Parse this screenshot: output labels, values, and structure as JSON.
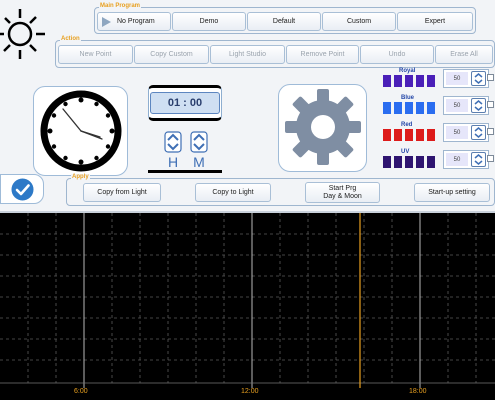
{
  "main_program": {
    "title": "Main Program",
    "buttons": [
      "No Program",
      "Demo",
      "Default",
      "Custom",
      "Expert"
    ]
  },
  "action": {
    "title": "Action",
    "buttons": [
      "New Point",
      "Copy Custom",
      "Light Studio",
      "Remove Point",
      "Undo",
      "Erase All"
    ]
  },
  "time": {
    "display": "01 : 00",
    "hour_label": "H",
    "minute_label": "M"
  },
  "channels": [
    {
      "name": "Royal",
      "value": "50",
      "color": "#4a1fb8"
    },
    {
      "name": "Blue",
      "value": "50",
      "color": "#2a6df0"
    },
    {
      "name": "Red",
      "value": "50",
      "color": "#dd1a1a"
    },
    {
      "name": "UV",
      "value": "50",
      "color": "#2e1470"
    }
  ],
  "apply": {
    "title": "Apply",
    "buttons": [
      "Copy  from  Light",
      "Copy  to  Light",
      "Start Prg\nDay & Moon",
      "Start-up setting"
    ]
  },
  "chart": {
    "x_ticks": [
      "6:00",
      "12:00",
      "18:00"
    ],
    "marker_color": "#e8a020"
  }
}
